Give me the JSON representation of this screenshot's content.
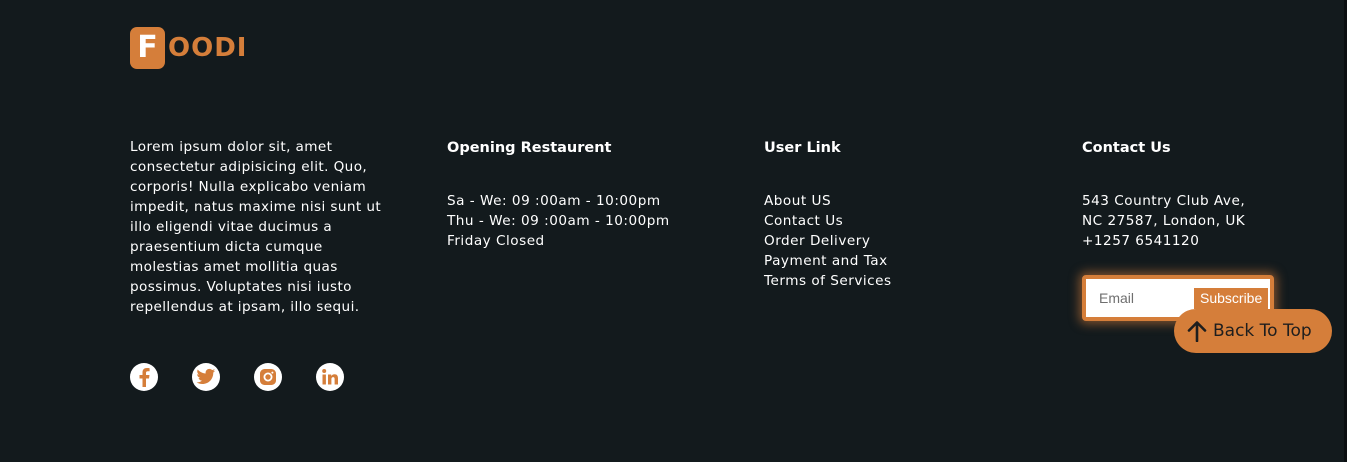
{
  "brand": {
    "badge_letter": "F",
    "rest": "OODI",
    "accent": "#d57e3a",
    "background": "#131a1d"
  },
  "about": {
    "text": "Lorem ipsum dolor sit, amet consectetur adipisicing elit. Quo, corporis! Nulla explicabo veniam impedit, natus maxime nisi sunt ut illo eligendi vitae ducimus a praesentium dicta cumque molestias amet mollitia quas possimus. Voluptates nisi iusto repellendus at ipsam, illo sequi."
  },
  "opening": {
    "title": "Opening Restaurent",
    "lines": [
      "Sa - We: 09 :00am - 10:00pm",
      "Thu - We: 09 :00am - 10:00pm",
      "Friday Closed"
    ]
  },
  "user_links": {
    "title": "User Link",
    "items": [
      "About US",
      "Contact Us",
      "Order Delivery",
      "Payment and Tax",
      "Terms of Services"
    ]
  },
  "contact": {
    "title": "Contact Us",
    "lines": [
      "543 Country Club Ave,",
      "NC 27587, London, UK",
      "+1257 6541120"
    ]
  },
  "newsletter": {
    "email_placeholder": "Email",
    "subscribe_label": "Subscribe"
  },
  "socials": [
    "facebook-icon",
    "twitter-icon",
    "instagram-icon",
    "linkedin-icon"
  ],
  "back_to_top": {
    "label": "Back To Top",
    "icon": "arrow-up-icon"
  }
}
